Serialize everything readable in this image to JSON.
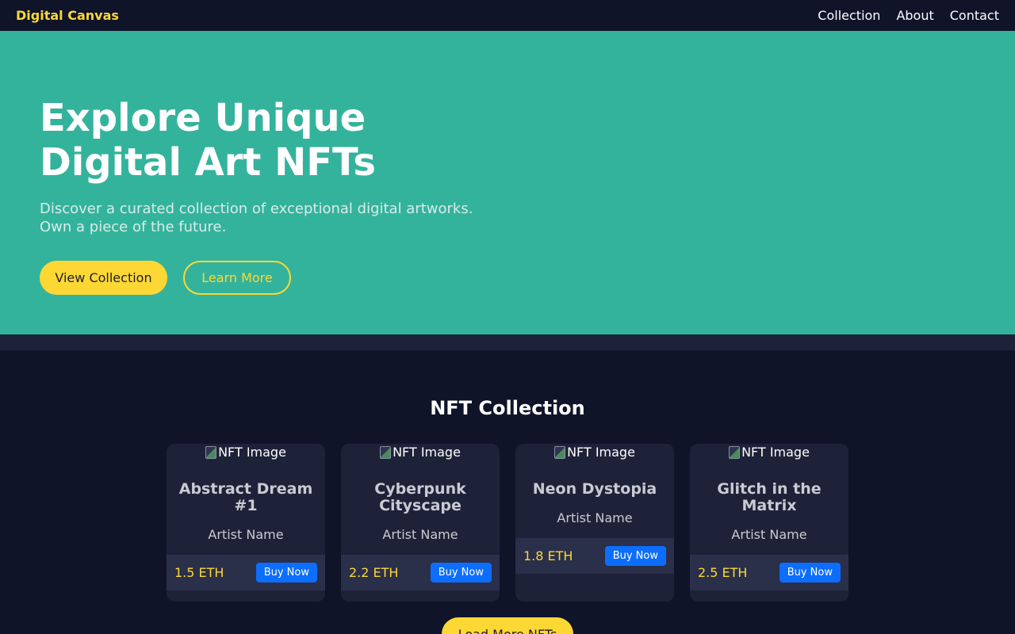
{
  "nav": {
    "brand": "Digital Canvas",
    "links": [
      "Collection",
      "About",
      "Contact"
    ]
  },
  "hero": {
    "title_line1": "Explore Unique",
    "title_line2": "Digital Art NFTs",
    "subtitle_line1": "Discover a curated collection of exceptional digital artworks.",
    "subtitle_line2": "Own a piece of the future.",
    "primary_button": "View Collection",
    "secondary_button": "Learn More"
  },
  "collection": {
    "title": "NFT Collection",
    "image_alt": "NFT Image",
    "cards": [
      {
        "title": "Abstract Dream #1",
        "artist": "Artist Name",
        "price": "1.5 ETH",
        "button": "Buy Now"
      },
      {
        "title": "Cyberpunk Cityscape",
        "artist": "Artist Name",
        "price": "2.2 ETH",
        "button": "Buy Now"
      },
      {
        "title": "Neon Dystopia",
        "artist": "Artist Name",
        "price": "1.8 ETH",
        "button": "Buy Now"
      },
      {
        "title": "Glitch in the Matrix",
        "artist": "Artist Name",
        "price": "2.5 ETH",
        "button": "Buy Now"
      }
    ],
    "load_more": "Load More NFTs"
  },
  "colors": {
    "accent": "#fdd835",
    "hero_bg": "#34b39c",
    "page_bg": "#0f1429",
    "card_bg": "#1e2239",
    "buy_button": "#0d6efd"
  }
}
